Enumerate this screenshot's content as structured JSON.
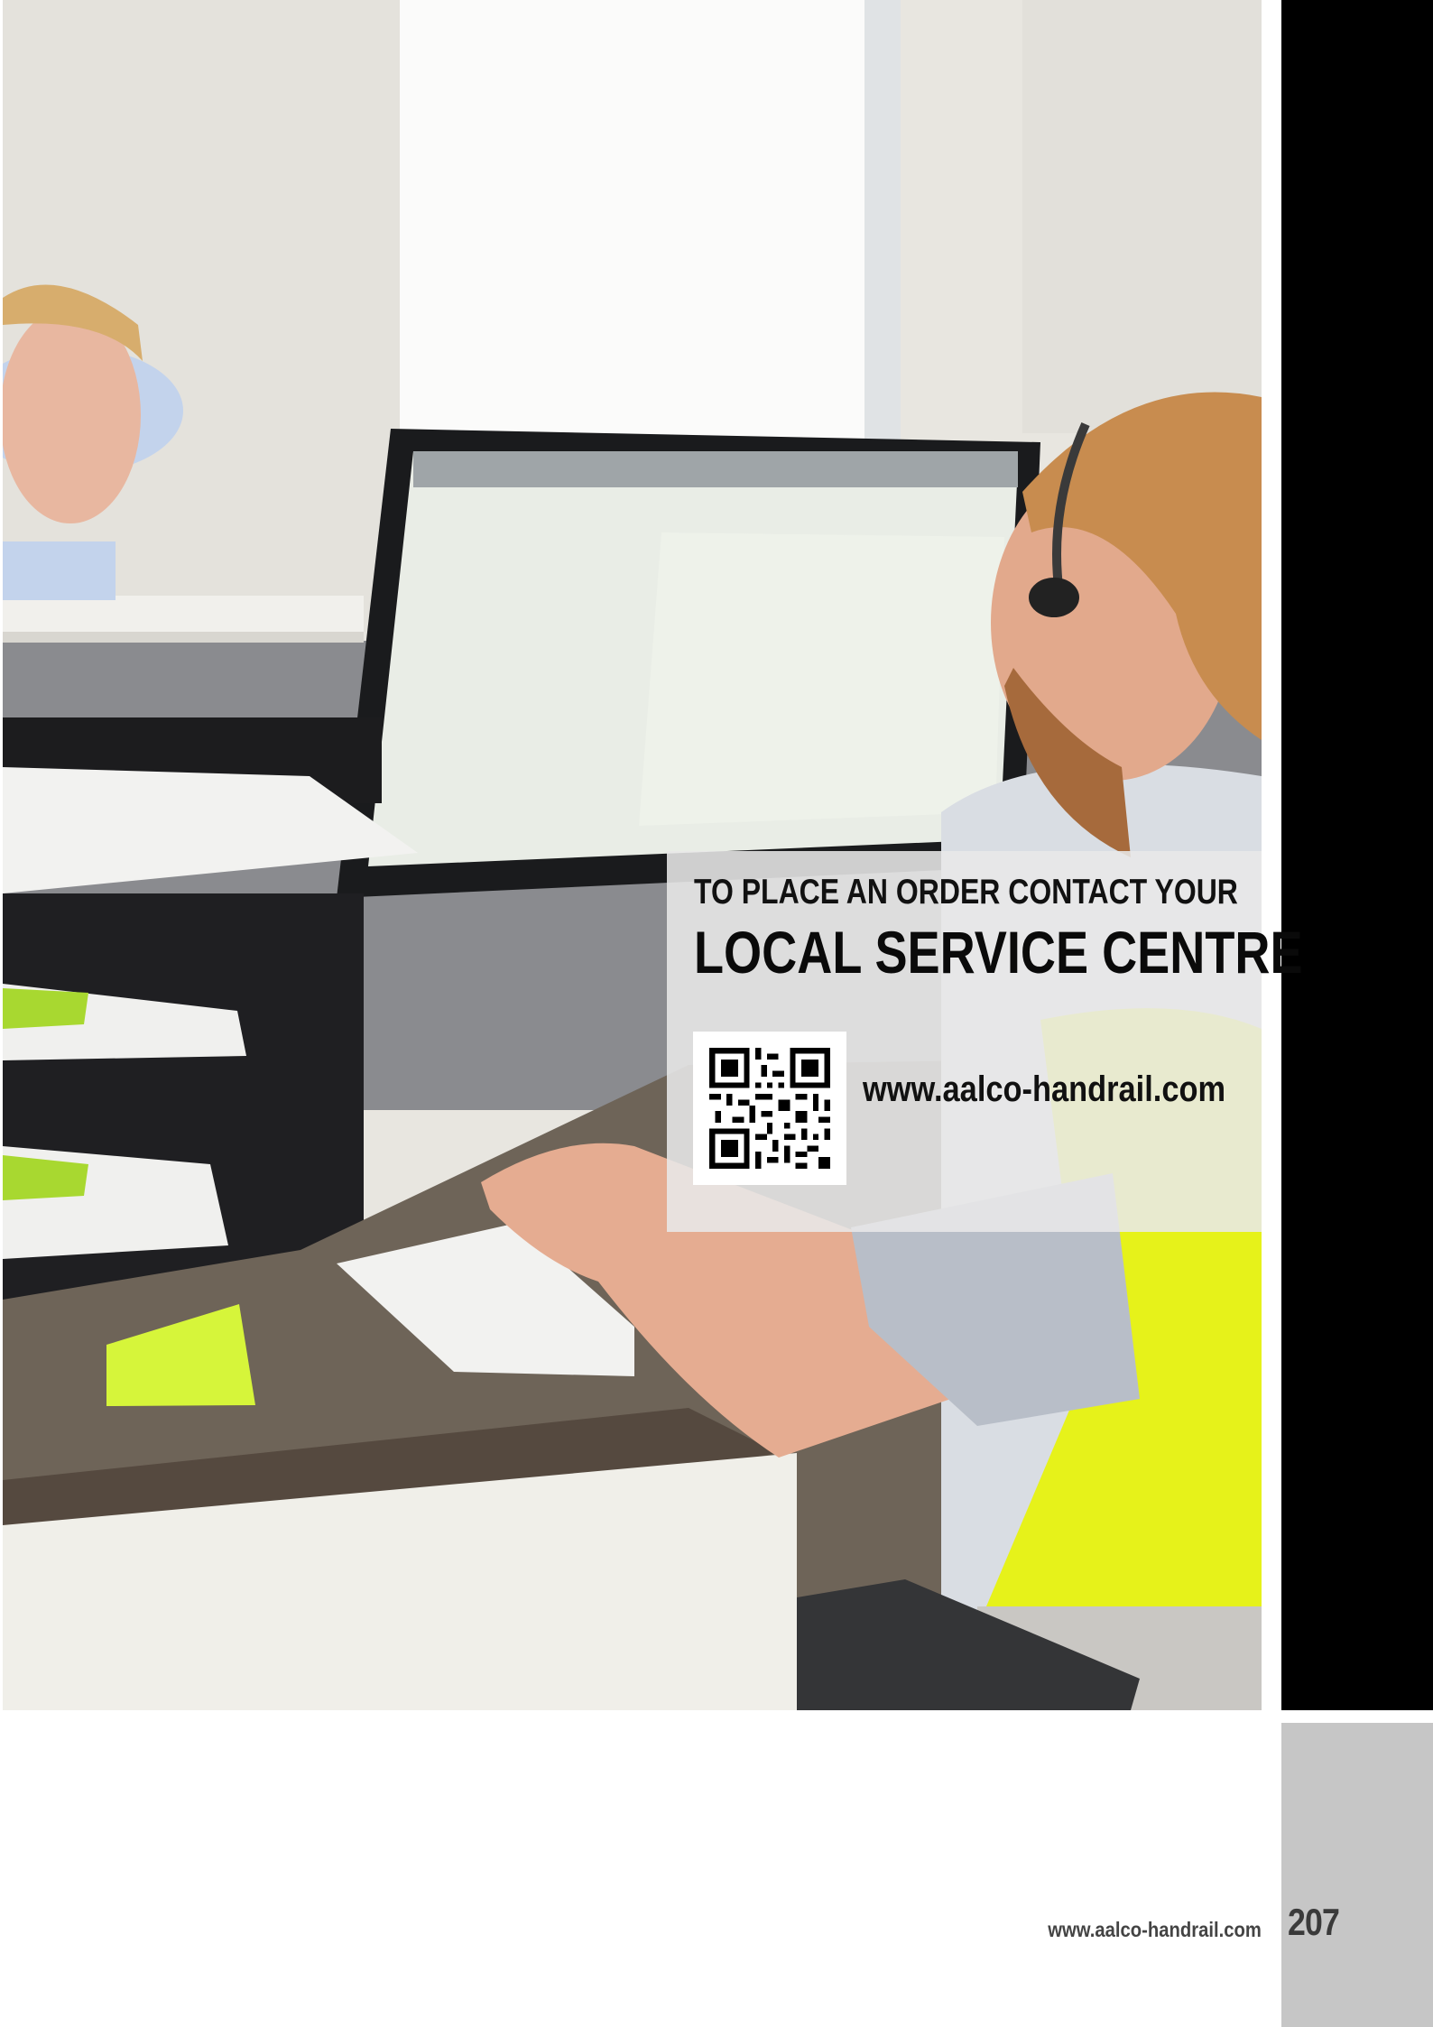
{
  "contact": {
    "line1": "TO PLACE AN ORDER CONTACT YOUR",
    "line2": "LOCAL SERVICE CENTRE",
    "url": "www.aalco-handrail.com"
  },
  "footer": {
    "url": "www.aalco-handrail.com",
    "page_number": "207"
  },
  "colors": {
    "strip": "#000000",
    "tab": "#c6c6c6",
    "panel": "#e8e8e8",
    "hi_vis": "#e6f21a"
  },
  "icons": {
    "qr": "qr-code-icon"
  }
}
